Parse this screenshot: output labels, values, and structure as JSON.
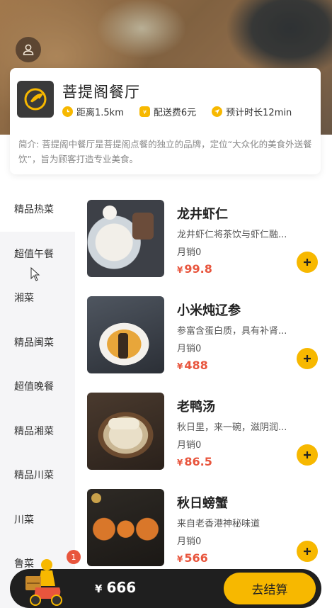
{
  "shop": {
    "name": "菩提阁餐厅",
    "distance": "距离1.5km",
    "delivery_fee": "配送费6元",
    "eta": "预计时长12min",
    "intro": "简介: 菩提阁中餐厅是菩提阁点餐的独立的品牌，定位“大众化的美食外送餐饮”，旨为顾客打造专业美食。"
  },
  "categories": [
    {
      "label": "精品热菜",
      "active": true
    },
    {
      "label": "超值午餐",
      "active": false
    },
    {
      "label": "湘菜",
      "active": false
    },
    {
      "label": "精品闽菜",
      "active": false
    },
    {
      "label": "超值晚餐",
      "active": false
    },
    {
      "label": "精品湘菜",
      "active": false
    },
    {
      "label": "精品川菜",
      "active": false
    },
    {
      "label": "川菜",
      "active": false
    },
    {
      "label": "鲁菜",
      "active": false
    }
  ],
  "products": [
    {
      "name": "龙井虾仁",
      "desc": "龙井虾仁将茶饮与虾仁融...",
      "sales": "月销0",
      "currency": "¥",
      "price": "99.8"
    },
    {
      "name": "小米炖辽参",
      "desc": "参富含蛋白质，具有补肾...",
      "sales": "月销0",
      "currency": "¥",
      "price": "488"
    },
    {
      "name": "老鸭汤",
      "desc": "秋日里，来一碗，滋阴润...",
      "sales": "月销0",
      "currency": "¥",
      "price": "86.5"
    },
    {
      "name": "秋日螃蟹",
      "desc": "来自老香港神秘味道",
      "sales": "月销0",
      "currency": "¥",
      "price": "566"
    }
  ],
  "cart": {
    "badge": "1",
    "currency": "¥",
    "total": "666",
    "checkout_label": "去结算"
  },
  "colors": {
    "accent": "#f7b800",
    "price": "#e8553d",
    "cart_bar": "#1f1f1f"
  },
  "icons": {
    "user": "user-icon",
    "distance": "clock-icon",
    "fee": "money-bag-icon",
    "eta": "navigation-icon",
    "add": "plus-icon",
    "cart": "delivery-rider-icon"
  }
}
